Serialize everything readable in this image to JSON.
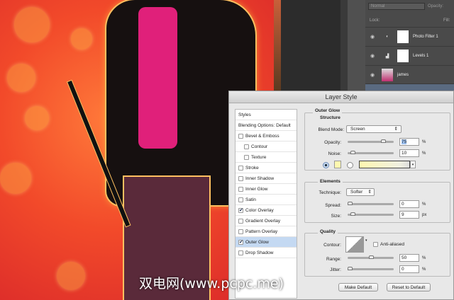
{
  "watermark": "双电网(www.pcpc.me)",
  "layers_panel": {
    "blend_mode": "Normal",
    "opacity_label": "Opacity:",
    "lock_label": "Lock:",
    "fill_label": "Fill:",
    "layers": [
      {
        "name": "Photo Filter 1"
      },
      {
        "name": "Levels 1"
      },
      {
        "name": "james"
      }
    ]
  },
  "dialog": {
    "title": "Layer Style",
    "styles": [
      {
        "label": "Styles"
      },
      {
        "label": "Blending Options: Default"
      },
      {
        "label": "Bevel & Emboss",
        "checked": false
      },
      {
        "label": "Contour",
        "checked": false
      },
      {
        "label": "Texture",
        "checked": false
      },
      {
        "label": "Stroke",
        "checked": false
      },
      {
        "label": "Inner Shadow",
        "checked": false
      },
      {
        "label": "Inner Glow",
        "checked": false
      },
      {
        "label": "Satin",
        "checked": false
      },
      {
        "label": "Color Overlay",
        "checked": true
      },
      {
        "label": "Gradient Overlay",
        "checked": false
      },
      {
        "label": "Pattern Overlay",
        "checked": false
      },
      {
        "label": "Outer Glow",
        "checked": true,
        "selected": true
      },
      {
        "label": "Drop Shadow",
        "checked": false
      }
    ],
    "section_title": "Outer Glow",
    "structure": {
      "title": "Structure",
      "blend_mode_label": "Blend Mode:",
      "blend_mode": "Screen",
      "opacity_label": "Opacity:",
      "opacity": "75",
      "noise_label": "Noise:",
      "noise": "10",
      "unit": "%",
      "glow_color": "#fff7b0"
    },
    "elements": {
      "title": "Elements",
      "technique_label": "Technique:",
      "technique": "Softer",
      "spread_label": "Spread:",
      "spread": "0",
      "size_label": "Size:",
      "size": "9",
      "pct": "%",
      "px": "px"
    },
    "quality": {
      "title": "Quality",
      "contour_label": "Contour:",
      "anti_aliased_label": "Anti-aliased",
      "range_label": "Range:",
      "range": "50",
      "jitter_label": "Jitter:",
      "jitter": "0",
      "unit": "%"
    },
    "make_default": "Make Default",
    "reset_default": "Reset to Default"
  }
}
